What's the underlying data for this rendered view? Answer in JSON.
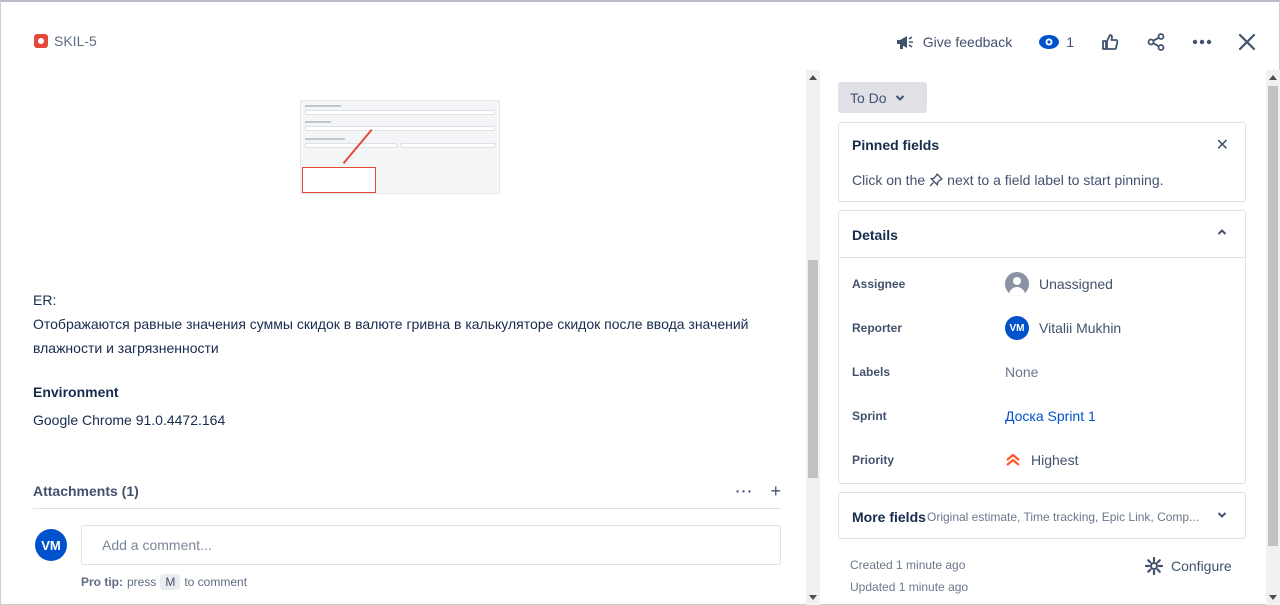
{
  "header": {
    "issue_key": "SKIL-5",
    "feedback_label": "Give feedback",
    "watchers_count": "1"
  },
  "description": {
    "er_label": "ER:",
    "er_text": "Отображаются равные значения суммы скидок в валюте гривна в калькуляторе скидок после ввода значений влажности и загрязненности"
  },
  "environment": {
    "heading": "Environment",
    "value": "Google Chrome 91.0.4472.164"
  },
  "attachments": {
    "title": "Attachments (1)"
  },
  "comment": {
    "avatar_initials": "VM",
    "placeholder": "Add a comment...",
    "pro_tip_label": "Pro tip:",
    "pro_tip_press": "press",
    "pro_tip_key": "M",
    "pro_tip_suffix": "to comment"
  },
  "sidebar": {
    "status": "To Do",
    "pinned": {
      "title": "Pinned fields",
      "hint_before": "Click on the",
      "hint_after": "next to a field label to start pinning."
    },
    "details": {
      "title": "Details",
      "fields": [
        {
          "label": "Assignee",
          "value": "Unassigned"
        },
        {
          "label": "Reporter",
          "value": "Vitalii Mukhin",
          "initials": "VM"
        },
        {
          "label": "Labels",
          "value": "None"
        },
        {
          "label": "Sprint",
          "value": "Доска Sprint 1"
        },
        {
          "label": "Priority",
          "value": "Highest"
        }
      ]
    },
    "more_fields": {
      "title": "More fields",
      "subtitle": "Original estimate, Time tracking, Epic Link, Comp..."
    },
    "created": "Created 1 minute ago",
    "updated": "Updated 1 minute ago",
    "configure_label": "Configure"
  },
  "colors": {
    "bug": "#e5493a",
    "link": "#0052cc",
    "priority_highest": "#ff5630"
  }
}
